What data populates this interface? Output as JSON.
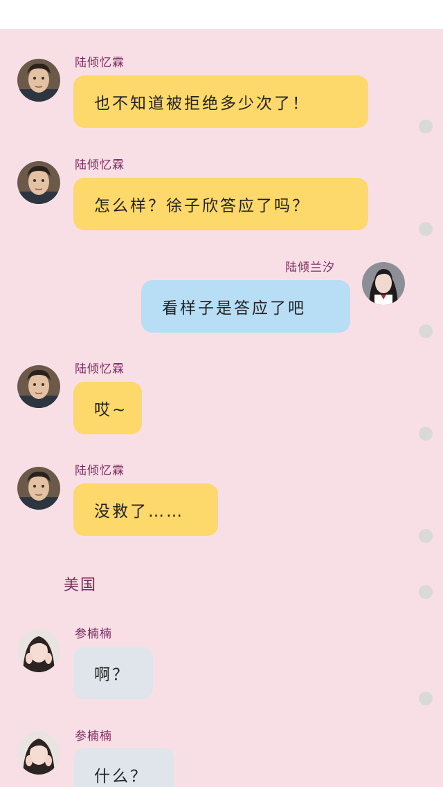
{
  "messages": [
    {
      "sender": "陆倾忆霖",
      "text": "也不知道被拒绝多少次了！",
      "side": "left",
      "color": "yellow",
      "avatar": "male"
    },
    {
      "sender": "陆倾忆霖",
      "text": "怎么样？徐子欣答应了吗？",
      "side": "left",
      "color": "yellow",
      "avatar": "male"
    },
    {
      "sender": "陆倾兰汐",
      "text": "看样子是答应了吧",
      "side": "right",
      "color": "blue",
      "avatar": "female"
    },
    {
      "sender": "陆倾忆霖",
      "text": "哎~",
      "side": "left",
      "color": "yellow",
      "avatar": "male"
    },
    {
      "sender": "陆倾忆霖",
      "text": "没救了……",
      "side": "left",
      "color": "yellow",
      "avatar": "male"
    },
    {
      "sender": "参楠楠",
      "text": "啊？",
      "side": "left",
      "color": "gray",
      "avatar": "female2"
    },
    {
      "sender": "参楠楠",
      "text": "什么？",
      "side": "left",
      "color": "gray",
      "avatar": "female2"
    }
  ],
  "location_label": "美国",
  "colors": {
    "background": "#f8dfe6",
    "yellow_bubble": "#fdd86a",
    "blue_bubble": "#b8def5",
    "gray_bubble": "#dfe5ea",
    "name_text": "#7a2a5e"
  }
}
